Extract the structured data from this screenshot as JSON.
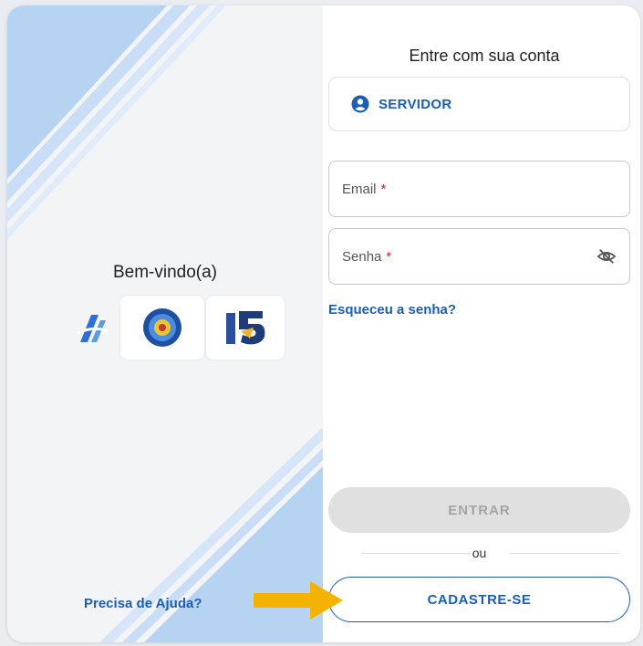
{
  "left_panel": {
    "welcome": "Bem-vindo(a)",
    "help_link": "Precisa de Ajuda?",
    "logos": [
      "logo-ifsc",
      "logo-alice",
      "logo-uniasselvi"
    ]
  },
  "login": {
    "title": "Entre com sua conta",
    "role_button": "SERVIDOR",
    "email_placeholder": "Email",
    "password_placeholder": "Senha",
    "required_mark": "*",
    "forgot_link": "Esqueceu a senha?",
    "enter_button": "ENTRAR",
    "divider_text": "ou",
    "signup_button": "CADASTRE-SE"
  },
  "colors": {
    "accent": "#1a5fb4",
    "arrow": "#f5b301",
    "stripe": "#b7d3f2",
    "required": "#c62828"
  },
  "icons": [
    "account-circle-icon",
    "visibility-off-icon",
    "arrow-right-icon"
  ]
}
